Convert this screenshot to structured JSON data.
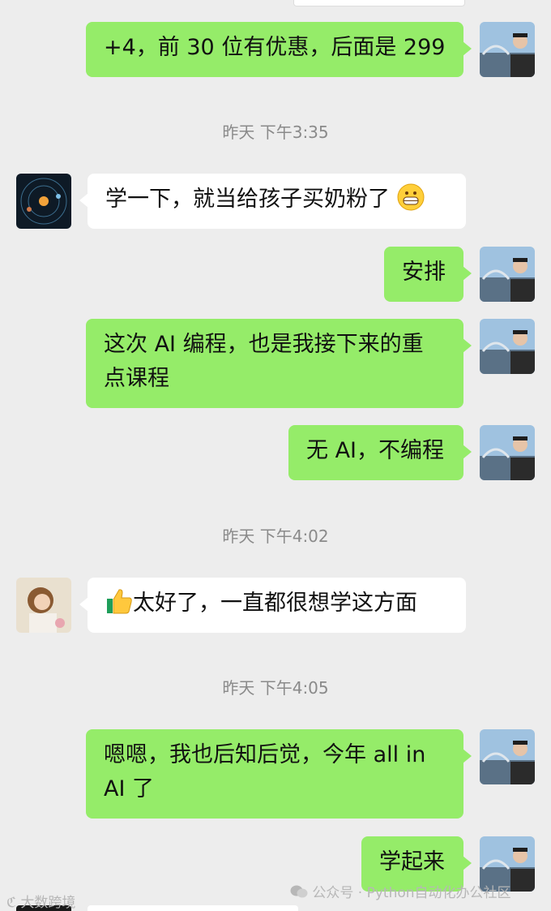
{
  "timestamps": {
    "t1": "昨天 下午3:35",
    "t2": "昨天 下午4:02",
    "t3": "昨天 下午4:05"
  },
  "messages": [
    {
      "id": "m1",
      "side": "right",
      "text": "+4，前 30 位有优惠，后面是 299"
    },
    {
      "id": "m2",
      "side": "left",
      "text": "学一下，就当给孩子买奶粉了",
      "emoji": "grinning-face-emoji"
    },
    {
      "id": "m3",
      "side": "right",
      "text": "安排"
    },
    {
      "id": "m4",
      "side": "right",
      "line1": "这次 AI 编程，也是我接下来的重",
      "line2": "点课程"
    },
    {
      "id": "m5",
      "side": "right",
      "text": "无 AI，不编程"
    },
    {
      "id": "m6",
      "side": "left",
      "text": "太好了，一直都很想学这方面",
      "emoji": "thumbs-up-emoji"
    },
    {
      "id": "m7",
      "side": "right",
      "line1": "嗯嗯，我也后知后觉，今年 all in",
      "line2": "AI 了"
    },
    {
      "id": "m8",
      "side": "right",
      "text": "学起来"
    }
  ],
  "watermark": {
    "left": "大数跨境",
    "right": "公众号 · Python自动化办公社区"
  },
  "colors": {
    "background": "#ededed",
    "outgoing_bubble": "#95ec69",
    "incoming_bubble": "#ffffff",
    "timestamp_text": "#8a8a8a"
  }
}
